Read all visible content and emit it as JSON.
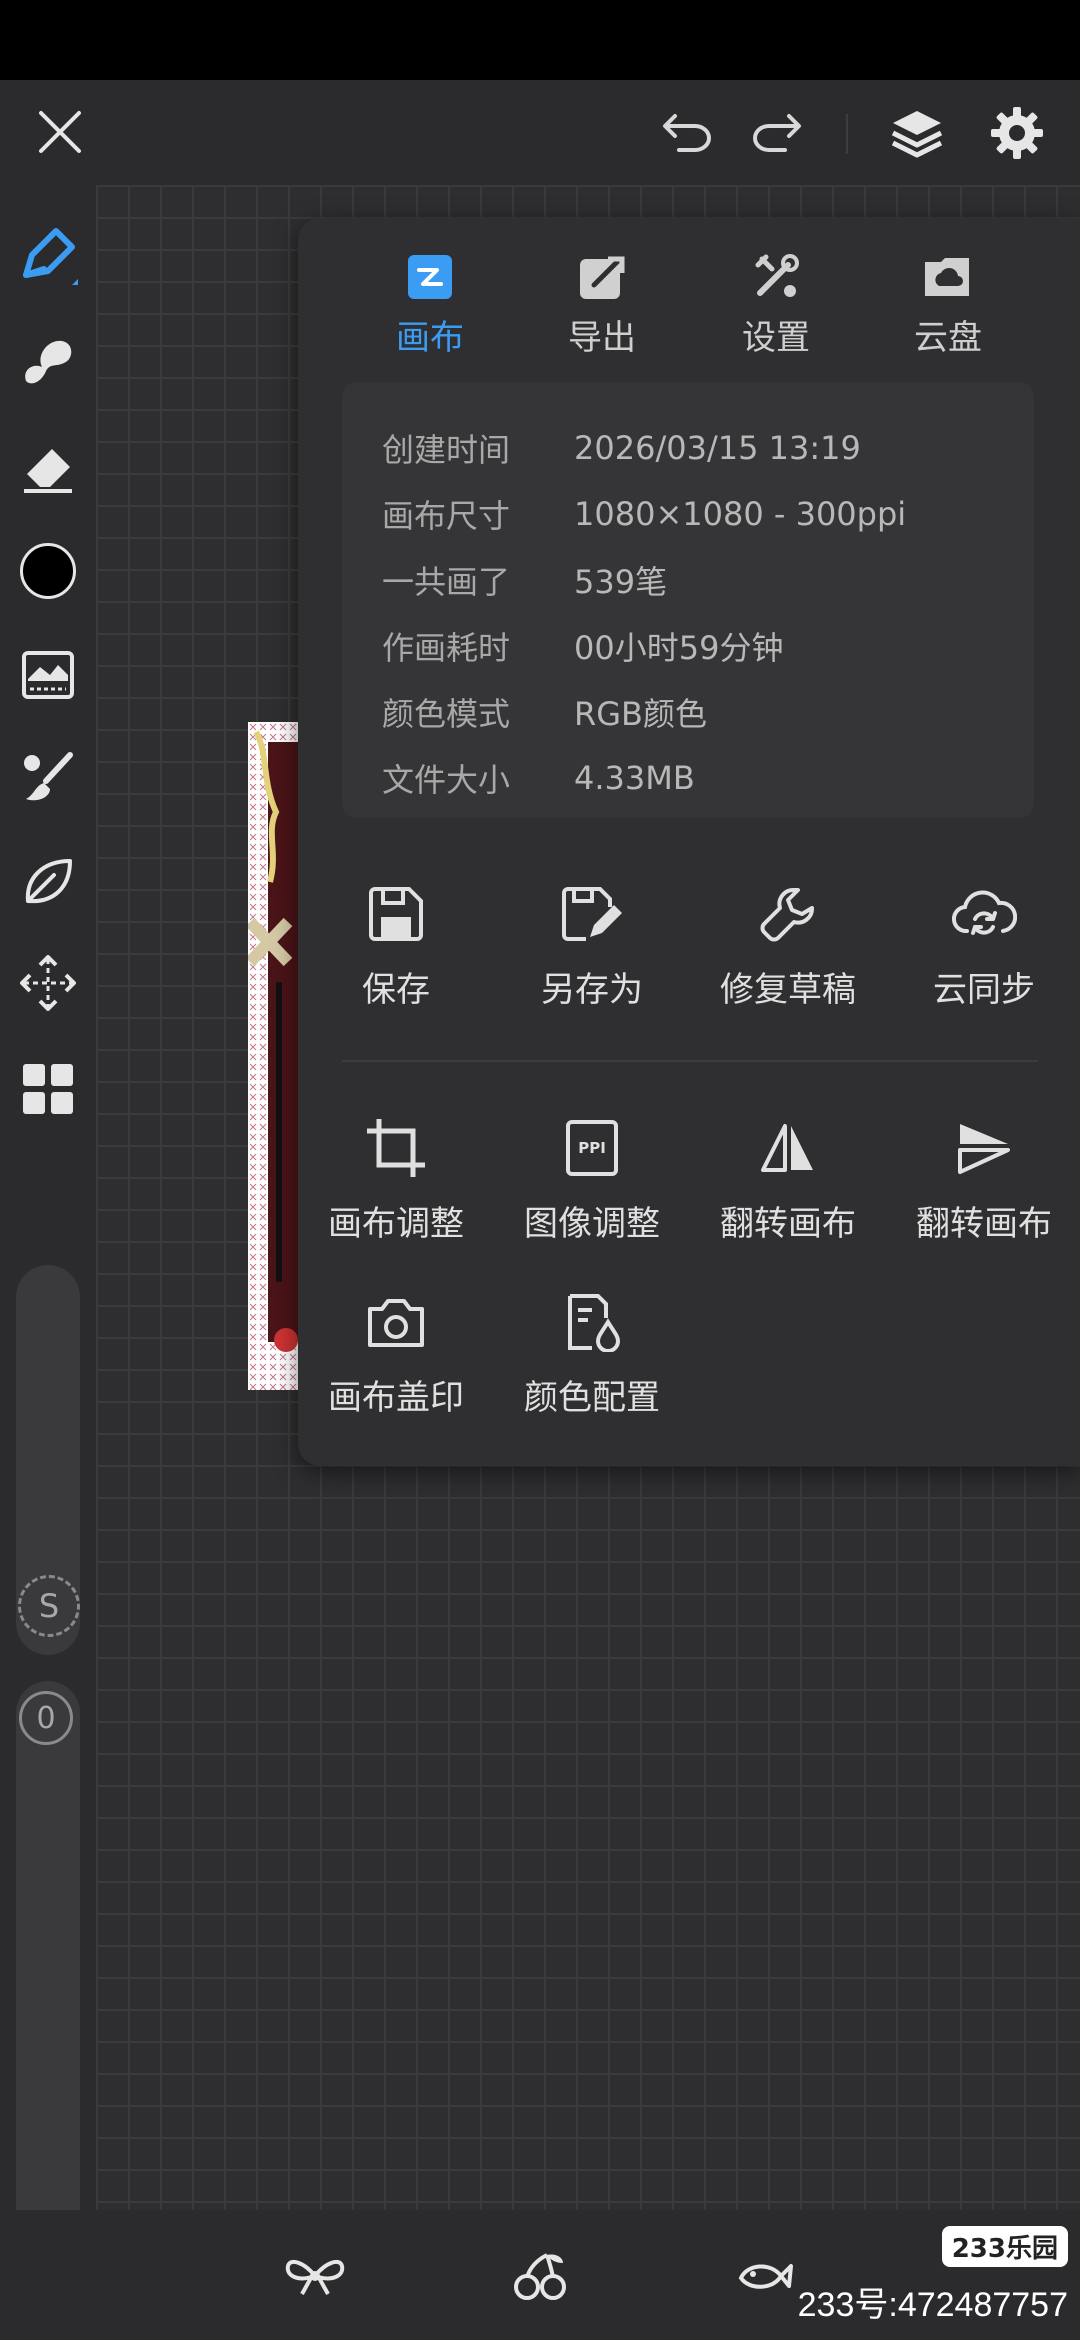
{
  "colors": {
    "accent": "#3b9cf3",
    "panel": "#2f2f31",
    "background": "#2b2b2d"
  },
  "topbar": {
    "icons": [
      "close-icon",
      "undo-icon",
      "redo-icon",
      "layers-icon",
      "settings-gear-icon"
    ]
  },
  "left_toolbar": {
    "tools": [
      "pen-brush-icon",
      "smudge-icon",
      "eraser-icon",
      "color-swatch",
      "adjust-image-icon",
      "brush-selector-icon",
      "leaf-icon",
      "move-transform-icon",
      "grid-layout-icon"
    ],
    "slider_size_label": "S",
    "slider_opacity_label": "0"
  },
  "panel": {
    "tabs": [
      {
        "label": "画布",
        "icon": "canvas-icon",
        "active": true
      },
      {
        "label": "导出",
        "icon": "export-icon",
        "active": false
      },
      {
        "label": "设置",
        "icon": "settings-tools-icon",
        "active": false
      },
      {
        "label": "云盘",
        "icon": "cloud-folder-icon",
        "active": false
      }
    ],
    "info": [
      {
        "key": "创建时间",
        "value": "2026/03/15 13:19"
      },
      {
        "key": "画布尺寸",
        "value": "1080×1080 - 300ppi"
      },
      {
        "key": "一共画了",
        "value": "539笔"
      },
      {
        "key": "作画耗时",
        "value": "00小时59分钟"
      },
      {
        "key": "颜色模式",
        "value": "RGB颜色"
      },
      {
        "key": "文件大小",
        "value": "4.33MB"
      }
    ],
    "actions_row1": [
      {
        "label": "保存",
        "icon": "save-icon"
      },
      {
        "label": "另存为",
        "icon": "save-as-icon"
      },
      {
        "label": "修复草稿",
        "icon": "wrench-icon"
      },
      {
        "label": "云同步",
        "icon": "cloud-sync-icon"
      }
    ],
    "actions_row2": [
      {
        "label": "画布调整",
        "icon": "crop-icon"
      },
      {
        "label": "图像调整",
        "icon": "ppi-icon"
      },
      {
        "label": "翻转画布",
        "icon": "flip-horizontal-icon"
      },
      {
        "label": "翻转画布",
        "icon": "flip-vertical-icon"
      }
    ],
    "actions_row3": [
      {
        "label": "画布盖印",
        "icon": "camera-icon"
      },
      {
        "label": "颜色配置",
        "icon": "color-profile-icon"
      }
    ],
    "ppi_text": "PPI"
  },
  "bottombar": {
    "icons": [
      "bow-icon",
      "cherry-icon",
      "fish-icon"
    ]
  },
  "watermark": {
    "logo": "233乐园",
    "text": "233号:472487757"
  }
}
